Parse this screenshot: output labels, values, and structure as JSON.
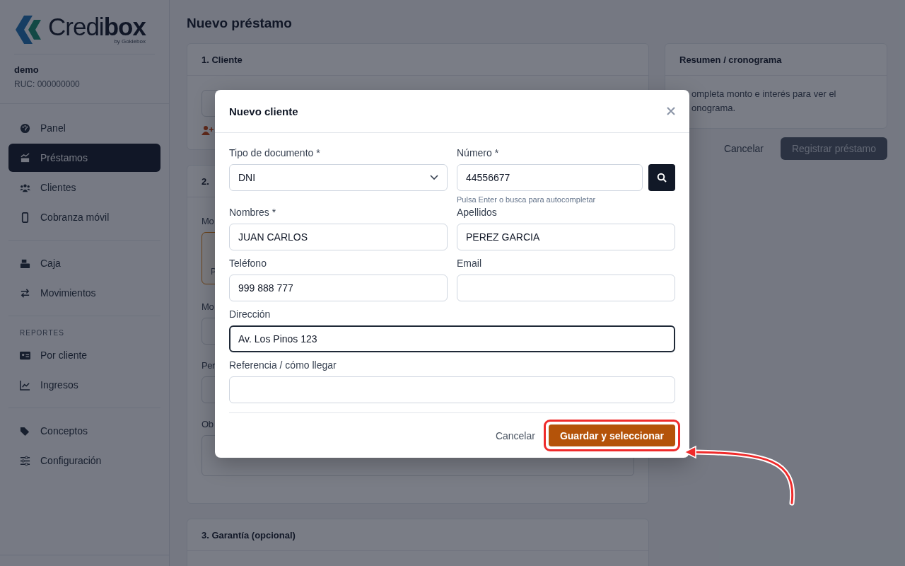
{
  "sidebar": {
    "brand": {
      "name_light": "Credi",
      "name_bold": "box",
      "tagline": "by Gokiebox"
    },
    "account": {
      "name": "demo",
      "ruc": "RUC: 000000000"
    },
    "sections": [
      {
        "items": [
          {
            "label": "Panel",
            "selected": false
          },
          {
            "label": "Préstamos",
            "selected": true
          },
          {
            "label": "Clientes",
            "selected": false
          },
          {
            "label": "Cobranza móvil",
            "selected": false
          }
        ]
      },
      {
        "items": [
          {
            "label": "Caja",
            "selected": false
          },
          {
            "label": "Movimientos",
            "selected": false
          }
        ]
      },
      {
        "title": "REPORTES",
        "items": [
          {
            "label": "Por cliente",
            "selected": false
          },
          {
            "label": "Ingresos",
            "selected": false
          }
        ]
      },
      {
        "items": [
          {
            "label": "Conceptos",
            "selected": false
          },
          {
            "label": "Configuración",
            "selected": false
          }
        ]
      }
    ]
  },
  "page": {
    "title": "Nuevo préstamo",
    "client_card": {
      "title": "1. Cliente"
    },
    "terms_card": {
      "title_fragment": "2.",
      "labels": [
        "Mo",
        "Mo",
        "Per",
        "Ob"
      ],
      "option_letters": [
        "P"
      ]
    },
    "guarantee_card": {
      "title": "3. Garantía (opcional)"
    },
    "summary_card": {
      "title": "Resumen / cronograma",
      "text_lines": [
        "ompleta monto e interés para ver el",
        "onograma."
      ]
    },
    "actions": {
      "cancel": "Cancelar",
      "submit": "Registrar préstamo",
      "submit_disabled": true
    }
  },
  "modal": {
    "title": "Nuevo cliente",
    "fields": [
      {
        "kind": "select",
        "label": "Tipo de documento *",
        "value": "DNI",
        "focused": false
      },
      {
        "kind": "search",
        "label": "Número *",
        "value": "44556677",
        "hint": "Pulsa Enter o busca para autocompletar",
        "focused": false
      },
      {
        "kind": "text",
        "label": "Nombres *",
        "value": "JUAN CARLOS",
        "focused": false
      },
      {
        "kind": "text",
        "label": "Apellidos",
        "value": "PEREZ GARCIA",
        "focused": false
      },
      {
        "kind": "text",
        "label": "Teléfono",
        "value": "999 888 777",
        "focused": false
      },
      {
        "kind": "text",
        "label": "Email",
        "focused": false
      },
      {
        "kind": "wide",
        "label": "Dirección",
        "value": "Av. Los Pinos 123",
        "focused": true
      },
      {
        "kind": "wide",
        "label": "Referencia / cómo llegar",
        "focused": false
      }
    ],
    "cancel": "Cancelar",
    "save": "Guardar y seleccionar",
    "save_highlighted": true
  }
}
